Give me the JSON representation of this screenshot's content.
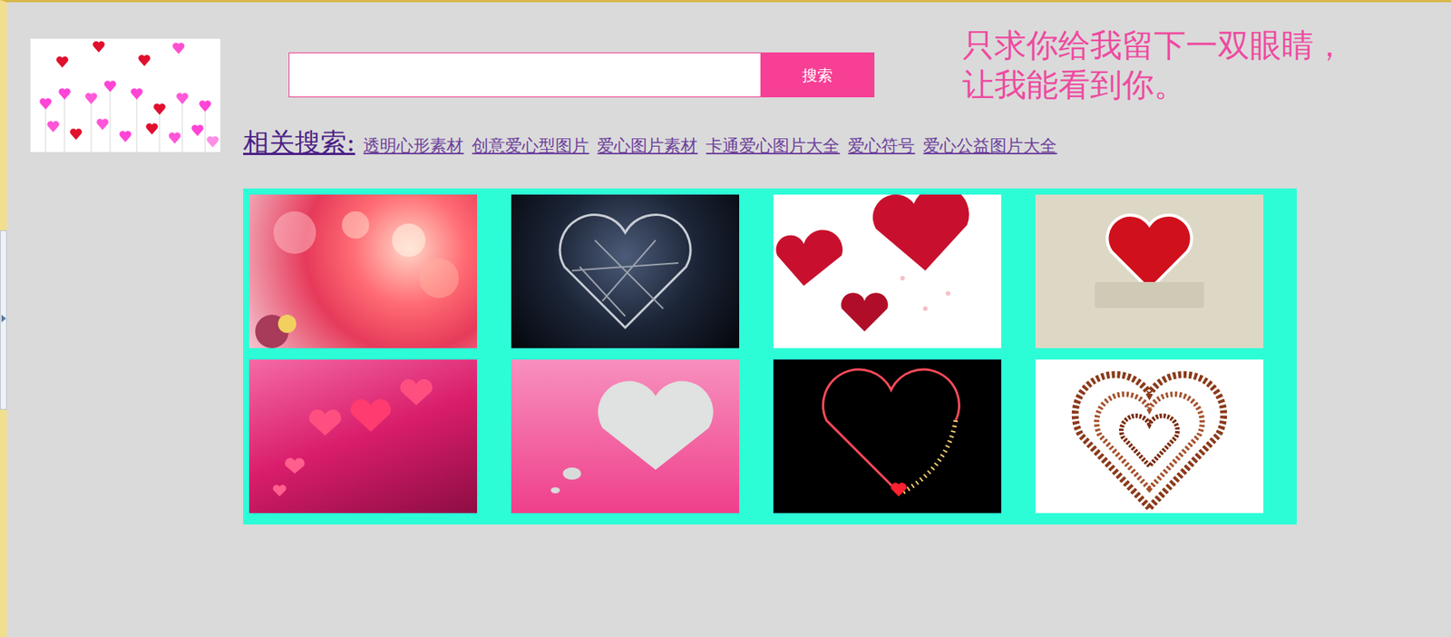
{
  "search": {
    "value": "",
    "button": "搜索"
  },
  "slogan": [
    "只求你给我留下一双眼睛，",
    "让我能看到你。"
  ],
  "related": {
    "label": "相关搜索:",
    "links": [
      "透明心形素材",
      "创意爱心型图片",
      "爱心图片素材",
      "卡通爱心图片大全",
      "爱心符号",
      "爱心公益图片大全"
    ]
  }
}
